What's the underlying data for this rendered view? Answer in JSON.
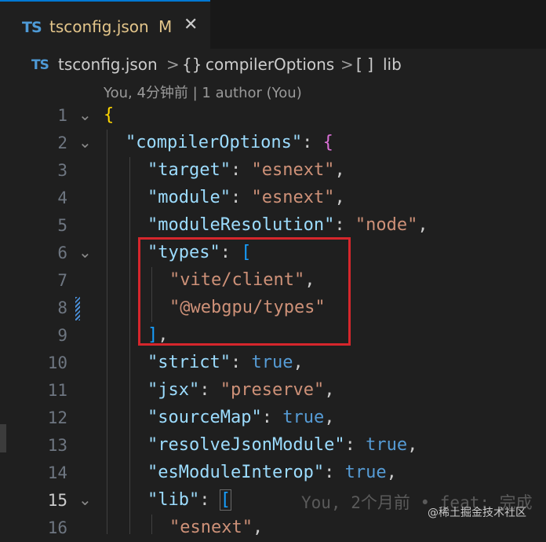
{
  "tab": {
    "icon": "TS",
    "title": "tsconfig.json",
    "modified": "M",
    "close": "✕"
  },
  "breadcrumb": {
    "icon": "TS",
    "file": "tsconfig.json",
    "sep": ">",
    "obj_icon": "{}",
    "obj": "compilerOptions",
    "arr_icon": "[ ]",
    "arr": "lib"
  },
  "blame": "You, 4分钟前 | 1 author (You)",
  "gutter": [
    "1",
    "2",
    "3",
    "4",
    "5",
    "6",
    "7",
    "8",
    "9",
    "10",
    "11",
    "12",
    "13",
    "14",
    "15",
    "16"
  ],
  "code": {
    "l1_open": "{",
    "l2_key": "\"compilerOptions\"",
    "l2_colon": ": ",
    "l2_open": "{",
    "l3_key": "\"target\"",
    "l3_colon": ": ",
    "l3_val": "\"esnext\"",
    "l3_comma": ",",
    "l4_key": "\"module\"",
    "l4_colon": ": ",
    "l4_val": "\"esnext\"",
    "l4_comma": ",",
    "l5_key": "\"moduleResolution\"",
    "l5_colon": ": ",
    "l5_val": "\"node\"",
    "l5_comma": ",",
    "l6_key": "\"types\"",
    "l6_colon": ": ",
    "l6_open": "[",
    "l7_val": "\"vite/client\"",
    "l7_comma": ",",
    "l8_val": "\"@webgpu/types\"",
    "l9_close": "]",
    "l9_comma": ",",
    "l10_key": "\"strict\"",
    "l10_colon": ": ",
    "l10_val": "true",
    "l10_comma": ",",
    "l11_key": "\"jsx\"",
    "l11_colon": ": ",
    "l11_val": "\"preserve\"",
    "l11_comma": ",",
    "l12_key": "\"sourceMap\"",
    "l12_colon": ": ",
    "l12_val": "true",
    "l12_comma": ",",
    "l13_key": "\"resolveJsonModule\"",
    "l13_colon": ": ",
    "l13_val": "true",
    "l13_comma": ",",
    "l14_key": "\"esModuleInterop\"",
    "l14_colon": ": ",
    "l14_val": "true",
    "l14_comma": ",",
    "l15_key": "\"lib\"",
    "l15_colon": ": ",
    "l15_open": "[",
    "l15_ghost": "You, 2个月前 • feat: 完成",
    "l16_val": "\"esnext\"",
    "l16_comma": ","
  },
  "watermark": "@稀土掘金技术社区",
  "colors": {
    "accent": "#0078d4",
    "highlight_box": "#d6262c"
  }
}
